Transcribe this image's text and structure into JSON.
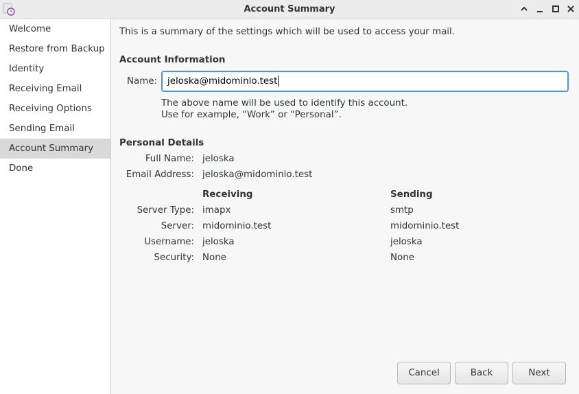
{
  "window": {
    "title": "Account Summary"
  },
  "sidebar": {
    "items": [
      {
        "label": "Welcome"
      },
      {
        "label": "Restore from Backup"
      },
      {
        "label": "Identity"
      },
      {
        "label": "Receiving Email"
      },
      {
        "label": "Receiving Options"
      },
      {
        "label": "Sending Email"
      },
      {
        "label": "Account Summary",
        "selected": true
      },
      {
        "label": "Done"
      }
    ]
  },
  "main": {
    "intro": "This is a summary of the settings which will be used to access your mail.",
    "account_info": {
      "heading": "Account Information",
      "name_label": "Name:",
      "name_value": "jeloska@midominio.test",
      "hint_line1": "The above name will be used to identify this account.",
      "hint_line2": "Use for example, “Work” or “Personal”."
    },
    "personal": {
      "heading": "Personal Details",
      "full_name_label": "Full Name:",
      "full_name": "jeloska",
      "email_label": "Email Address:",
      "email": "jeloska@midominio.test"
    },
    "servers": {
      "receiving_heading": "Receiving",
      "sending_heading": "Sending",
      "rows": [
        {
          "label": "Server Type:",
          "receiving": "imapx",
          "sending": "smtp"
        },
        {
          "label": "Server:",
          "receiving": "midominio.test",
          "sending": "midominio.test"
        },
        {
          "label": "Username:",
          "receiving": "jeloska",
          "sending": "jeloska"
        },
        {
          "label": "Security:",
          "receiving": "None",
          "sending": "None"
        }
      ]
    },
    "buttons": {
      "cancel": "Cancel",
      "back": "Back",
      "next": "Next"
    }
  },
  "icons": {
    "app": "mail-clock-icon",
    "minimize": "chevron-up-icon",
    "restore": "minimize-icon",
    "maximize": "maximize-icon",
    "close": "close-icon"
  },
  "colors": {
    "focus_border": "#5294e2",
    "selected_bg": "#d9d9d9",
    "app_icon_accent": "#8e44ad"
  }
}
